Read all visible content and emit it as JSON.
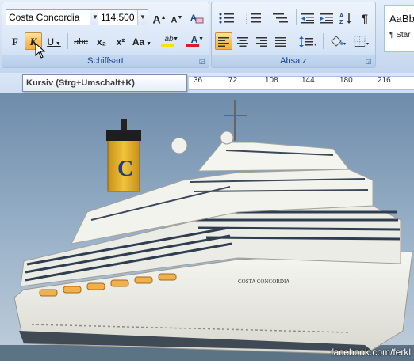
{
  "font": {
    "name": "Costa Concordia",
    "size": "114.500 t"
  },
  "font_group": {
    "label": "Schiffsart",
    "buttons": {
      "grow": "A",
      "shrink": "A",
      "bold": "F",
      "italic": "K",
      "underline": "U",
      "strike": "abc",
      "sub": "x₂",
      "sup": "x²",
      "case": "Aa",
      "highlight": "ab",
      "color": "A"
    }
  },
  "para_group": {
    "label": "Absatz",
    "pilcrow": "¶"
  },
  "styles": {
    "preview": "AaBb",
    "name": "¶ Star"
  },
  "tooltip": {
    "text": "Kursiv (Strg+Umschalt+K)"
  },
  "ruler": {
    "ticks": [
      "36",
      "72",
      "108",
      "144",
      "180",
      "216"
    ]
  },
  "photo": {
    "ship_name": "COSTA CONCORDIA",
    "funnel_letter": "C",
    "credit": "facebook.com/ferkl"
  },
  "colors": {
    "highlight": "#ffd66e",
    "ribbon": "#d0e0f4",
    "funnel": "#e8b92a",
    "hull": "#f4f4ef",
    "sky_top": "#7c97b4"
  }
}
